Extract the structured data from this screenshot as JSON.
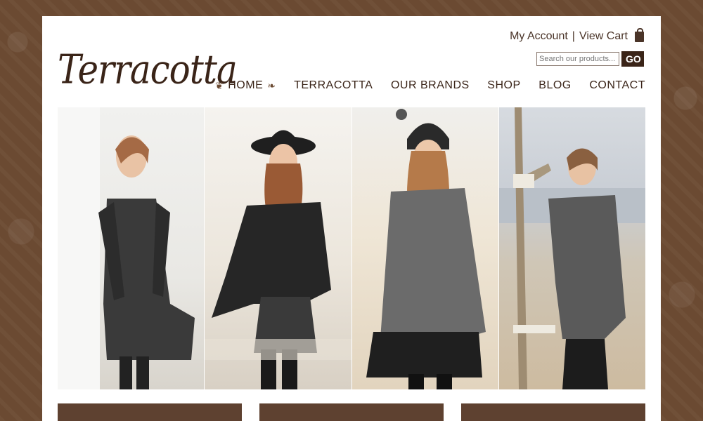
{
  "brand": {
    "logo_text": "Terracotta"
  },
  "account": {
    "my_account": "My Account",
    "separator": "|",
    "view_cart": "View Cart"
  },
  "search": {
    "placeholder": "Search our products...",
    "button_label": "GO"
  },
  "nav": {
    "items": [
      {
        "label": "HOME"
      },
      {
        "label": "TERRACOTTA"
      },
      {
        "label": "OUR BRANDS"
      },
      {
        "label": "SHOP"
      },
      {
        "label": "BLOG"
      },
      {
        "label": "CONTACT"
      }
    ],
    "home_ornament_icon": "leaf-ornament-icon"
  },
  "gallery": {
    "photos": [
      {
        "subject": "woman-lace-sleeve-dress"
      },
      {
        "subject": "woman-black-hat-jacket"
      },
      {
        "subject": "woman-beanie-grey-cardigan"
      },
      {
        "subject": "woman-scarf-driftwood-beach"
      }
    ]
  },
  "promos": {
    "items": [
      {
        "label": ""
      },
      {
        "label": ""
      },
      {
        "label": ""
      }
    ]
  },
  "colors": {
    "background": "#6b4a32",
    "brand_dark": "#3a2418",
    "text": "#4a3428",
    "promo": "#5e4130"
  }
}
